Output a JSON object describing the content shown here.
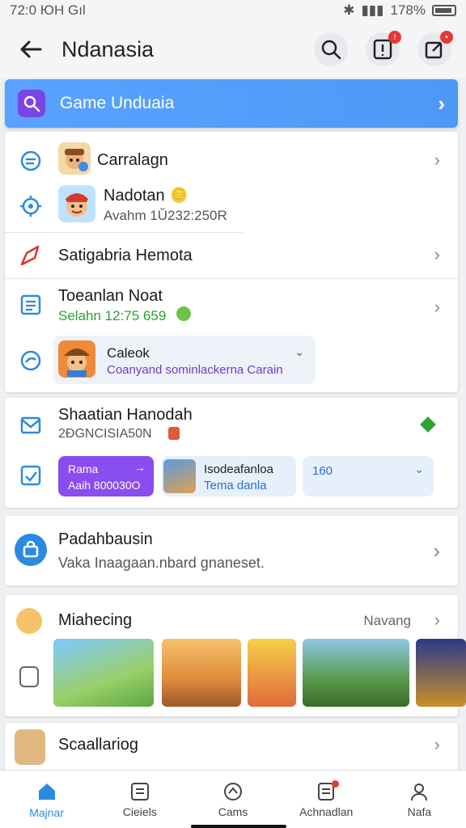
{
  "status": {
    "time": "72:0 ЮH Gıl",
    "battery": "178%"
  },
  "header": {
    "title": "Ndanasia"
  },
  "banner": {
    "label": "Game Unduaia"
  },
  "card1": {
    "item1": {
      "title": "Carralagn"
    },
    "item2": {
      "title": "Nadotan",
      "sub": "Avahm 1Ŭ232:250R"
    },
    "item3": {
      "title": "Satigabria Hemota"
    },
    "item4": {
      "title": "Toeanlan Noat",
      "sub": "Selahn 12:75 659"
    },
    "item5": {
      "title": "Caleok",
      "sub": "Coanyand sominlackerna Carain"
    }
  },
  "card2": {
    "title": "Shaatian Hanodah",
    "sub": "2ĐGNCISIA50N",
    "chipA": {
      "line1": "Rama",
      "line2": "Aaih 800030O"
    },
    "chipB": {
      "line1": "Isodeafanloa",
      "line2": "Tema danla"
    },
    "chipC": {
      "line1": "160"
    }
  },
  "card3": {
    "title": "Padahbausin",
    "sub": "Vaka Inaagaan.nbard gnaneset."
  },
  "card4": {
    "title": "Miahecing",
    "action": "Navang"
  },
  "card5": {
    "title": "Scaallariog"
  },
  "nav": [
    {
      "label": "Majnar"
    },
    {
      "label": "Cieiels"
    },
    {
      "label": "Cams"
    },
    {
      "label": "Achnadlan"
    },
    {
      "label": "Nafa"
    }
  ],
  "colors": {
    "accent": "#2b8ae0",
    "banner": "#4f98f5",
    "purple": "#7b45e6",
    "green": "#2aa52e"
  }
}
